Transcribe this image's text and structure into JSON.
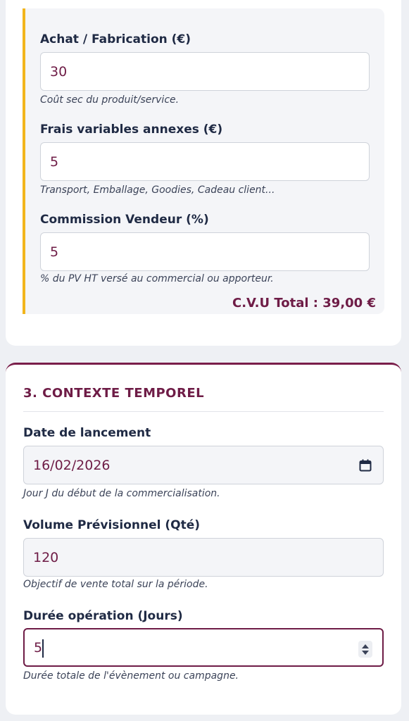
{
  "cvu": {
    "achat": {
      "label": "Achat / Fabrication (€)",
      "value": "30",
      "help": "Coût sec du produit/service."
    },
    "frais": {
      "label": "Frais variables annexes (€)",
      "value": "5",
      "help": "Transport, Emballage, Goodies, Cadeau client..."
    },
    "commission": {
      "label": "Commission Vendeur (%)",
      "value": "5",
      "help": "% du PV HT versé au commercial ou apporteur."
    },
    "total": "C.V.U Total : 39,00 €"
  },
  "contexte": {
    "title": "3. CONTEXTE TEMPOREL",
    "date": {
      "label": "Date de lancement",
      "value": "16/02/2026",
      "help": "Jour J du début de la commercialisation.",
      "icon": "calendar-icon"
    },
    "volume": {
      "label": "Volume Prévisionnel (Qté)",
      "value": "120",
      "help": "Objectif de vente total sur la période."
    },
    "duree": {
      "label": "Durée opération (Jours)",
      "value": "5",
      "help": "Durée totale de l'évènement ou campagne.",
      "icon": "spinner-icon"
    }
  },
  "colors": {
    "accent": "#6e1c46",
    "highlight": "#f2b51c",
    "text": "#1f2a44"
  }
}
